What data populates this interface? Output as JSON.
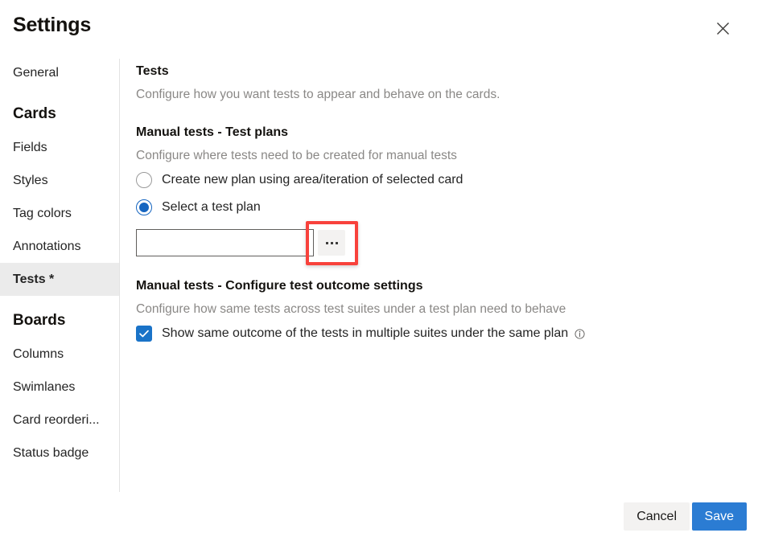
{
  "header": {
    "title": "Settings",
    "close_icon": "close-icon"
  },
  "sidebar": {
    "top_items": [
      {
        "label": "General",
        "selected": false
      }
    ],
    "groups": [
      {
        "title": "Cards",
        "items": [
          {
            "label": "Fields",
            "selected": false
          },
          {
            "label": "Styles",
            "selected": false
          },
          {
            "label": "Tag colors",
            "selected": false
          },
          {
            "label": "Annotations",
            "selected": false
          },
          {
            "label": "Tests *",
            "selected": true
          }
        ]
      },
      {
        "title": "Boards",
        "items": [
          {
            "label": "Columns",
            "selected": false
          },
          {
            "label": "Swimlanes",
            "selected": false
          },
          {
            "label": "Card reorderi...",
            "selected": false
          },
          {
            "label": "Status badge",
            "selected": false
          }
        ]
      }
    ]
  },
  "main": {
    "page_title": "Tests",
    "page_desc": "Configure how you want tests to appear and behave on the cards.",
    "sections": [
      {
        "title": "Manual tests - Test plans",
        "desc": "Configure where tests need to be created for manual tests",
        "radios": [
          {
            "label": "Create new plan using area/iteration of selected card",
            "checked": false
          },
          {
            "label": "Select a test plan",
            "checked": true
          }
        ],
        "plan_input": {
          "value": "",
          "placeholder": ""
        },
        "browse_button_label": "...",
        "browse_icon": "ellipsis-icon"
      },
      {
        "title": "Manual tests - Configure test outcome settings",
        "desc": "Configure how same tests across test suites under a test plan need to behave",
        "checkbox": {
          "label": "Show same outcome of the tests in multiple suites under the same plan",
          "checked": true,
          "info_icon": "info-circle-icon"
        }
      }
    ]
  },
  "footer": {
    "cancel_label": "Cancel",
    "save_label": "Save"
  },
  "colors": {
    "accent_blue": "#2b7cd3",
    "radio_blue": "#1565c0",
    "checkbox_blue": "#1a73c8",
    "highlight_red": "#f8423c",
    "selected_item_bg": "#ebebeb",
    "muted_text": "#8a8886"
  }
}
